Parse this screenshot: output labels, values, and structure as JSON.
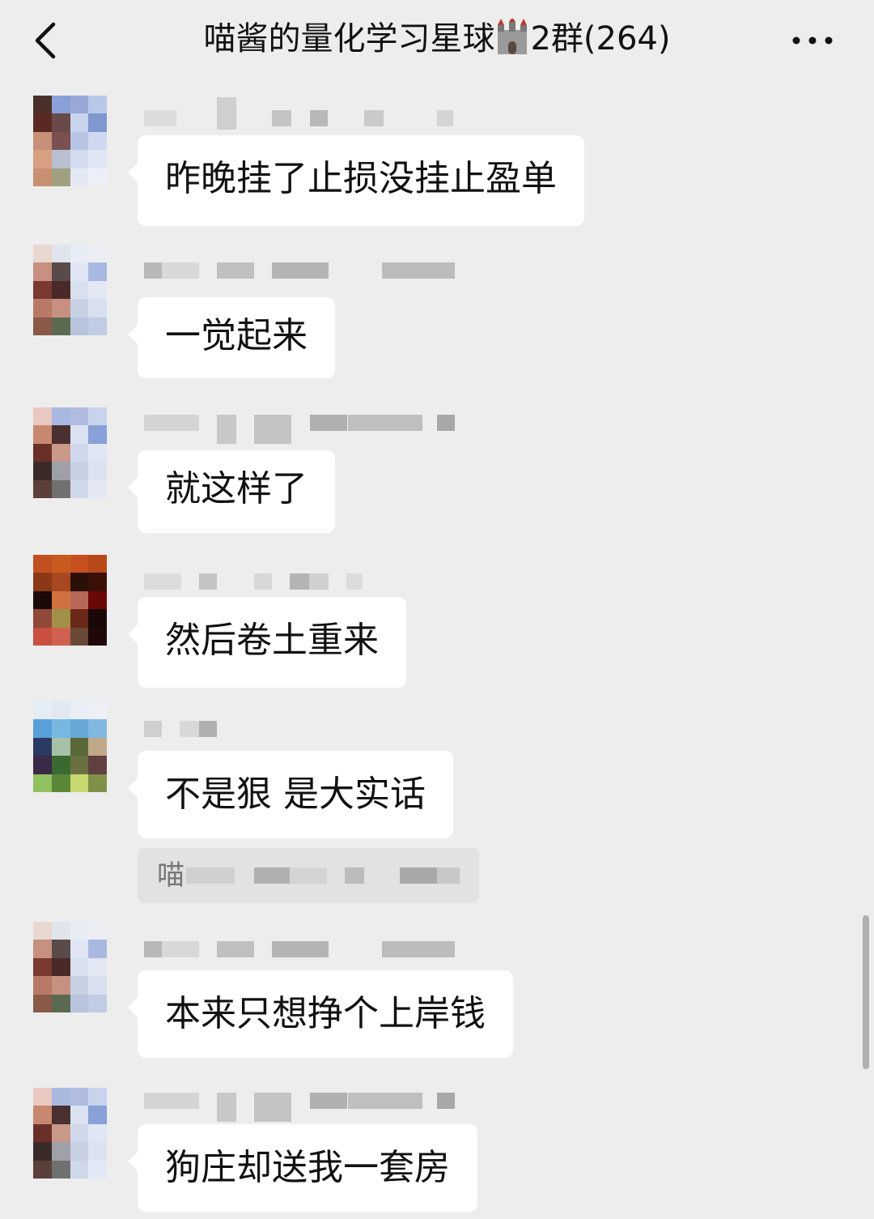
{
  "header": {
    "title_prefix": "喵酱的量化学习星球",
    "title_suffix": "2群(264)",
    "back_icon": "chevron-left-icon",
    "more_icon": "ellipsis-icon",
    "title_emoji": "castle-icon"
  },
  "messages": [
    {
      "text": "昨晚挂了止损没挂止盈单"
    },
    {
      "text": "一觉起来"
    },
    {
      "text": "就这样了"
    },
    {
      "text": "然后卷土重来"
    },
    {
      "text": "不是狠 是大实话"
    },
    {
      "text": "本来只想挣个上岸钱"
    },
    {
      "text": "狗庄却送我一套房"
    }
  ],
  "quote": {
    "prefix": "喵"
  },
  "colors": {
    "background": "#ededed",
    "bubble": "#ffffff",
    "quote_bg": "#e2e2e2",
    "text": "#111111"
  }
}
